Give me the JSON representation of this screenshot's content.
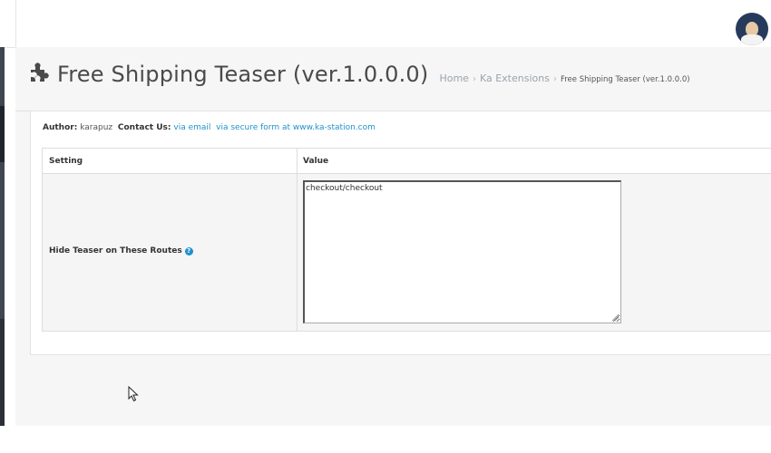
{
  "page": {
    "title": "Free Shipping Teaser (ver.1.0.0.0)",
    "icon": "puzzle-icon"
  },
  "breadcrumb": {
    "items": [
      {
        "label": "Home"
      },
      {
        "label": "Ka Extensions"
      },
      {
        "label": "Free Shipping Teaser (ver.1.0.0.0)"
      }
    ]
  },
  "author": {
    "label": "Author",
    "name": "karapuz",
    "contact_label": "Contact Us",
    "email_link": "via email",
    "form_link": "via secure form at www.ka-station.com"
  },
  "table": {
    "headers": [
      "Setting",
      "Value"
    ],
    "rows": [
      {
        "setting": "Hide Teaser on These Routes",
        "value": "checkout/checkout",
        "help_icon": "question-circle-icon"
      }
    ]
  },
  "colors": {
    "accent": "#1e91cf",
    "sidebar": "#3f4551",
    "avatar_bg": "#263a5c"
  }
}
